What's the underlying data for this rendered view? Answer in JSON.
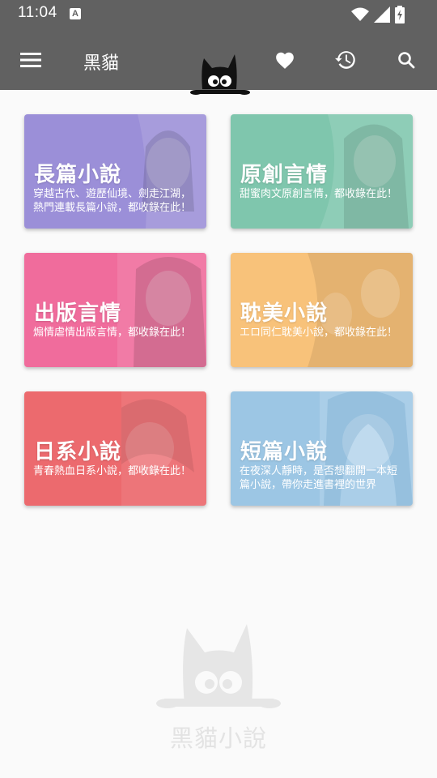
{
  "status_bar": {
    "time": "11:04",
    "notification_icon": "A",
    "icons": [
      "wifi-icon",
      "signal-icon",
      "battery-charging-icon"
    ]
  },
  "app_bar": {
    "title": "黑貓",
    "icons": [
      "menu-icon",
      "cat-logo-icon",
      "heart-icon",
      "history-icon",
      "search-icon"
    ],
    "color": "#616161"
  },
  "categories": [
    {
      "title": "長篇小說",
      "description": "穿越古代、遊歷仙境、劍走江湖，熱門連載長篇小說，都收錄在此！",
      "color": "#9b8fd8"
    },
    {
      "title": "原創言情",
      "description": "甜蜜肉文原創言情，都收錄在此！",
      "color": "#7fc6ad"
    },
    {
      "title": "出版言情",
      "description": "煽情虐情出版言情，都收錄在此！",
      "color": "#f06c9c"
    },
    {
      "title": "耽美小說",
      "description": "エロ同仁耽美小說，都收錄在此！",
      "color": "#f8c27a"
    },
    {
      "title": "日系小說",
      "description": "青春熱血日系小說，都收錄在此！",
      "color": "#ec6a6e"
    },
    {
      "title": "短篇小說",
      "description": "在夜深人靜時，是否想翻開一本短篇小說，帶你走進書裡的世界",
      "color": "#9cc6e4"
    }
  ],
  "watermark": {
    "text": "黑貓小說",
    "color": "#e3e3e3"
  }
}
